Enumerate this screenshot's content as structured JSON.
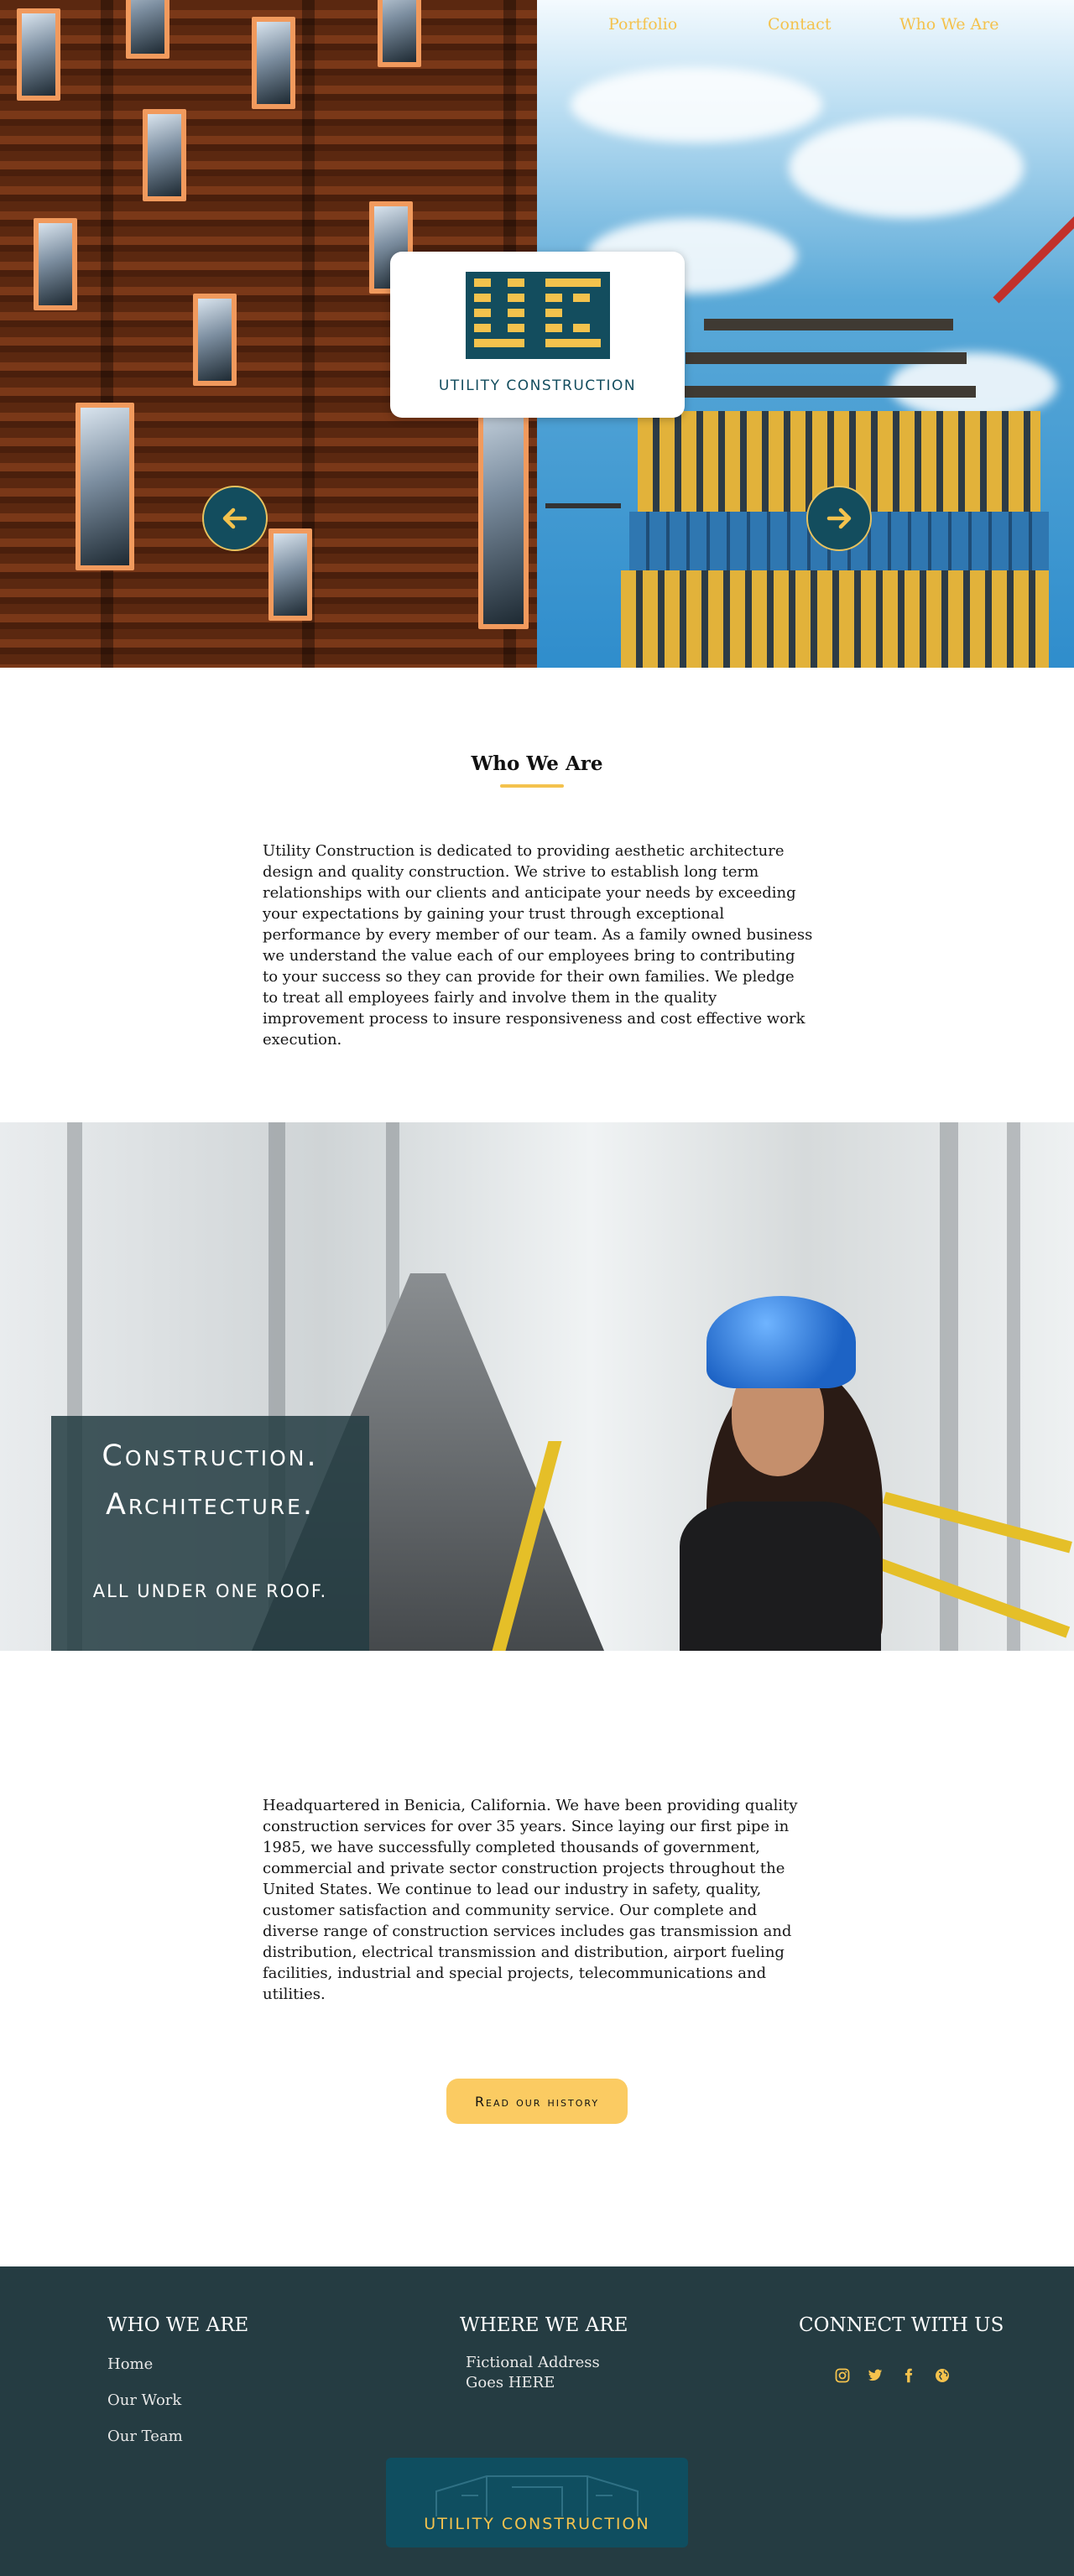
{
  "nav": {
    "items": [
      {
        "label": "Portfolio"
      },
      {
        "label": "Contact"
      },
      {
        "label": "Who We Are"
      }
    ]
  },
  "hero": {
    "logo_text": "UTILITY CONSTRUCTION",
    "prev_icon": "arrow-left-icon",
    "next_icon": "arrow-right-icon"
  },
  "who_we_are": {
    "title": "Who We Are",
    "paragraph": "Utility Construction is dedicated to providing aesthetic architecture design and quality construction. We strive to establish long term relationships with our clients and anticipate your needs by exceeding your expectations by gaining your trust through exceptional performance by every member of our team. As a family owned business we understand the value each of our employees bring to contributing to your success so they can provide for their own families. We pledge to treat all employees fairly and involve them in the quality improvement process to insure responsiveness and cost effective work execution."
  },
  "banner": {
    "line1": "Construction.",
    "line2": "Architecture.",
    "tagline": "ALL UNDER ONE ROOF."
  },
  "history": {
    "paragraph": "Headquartered in Benicia, California. We have been providing quality construction services for over 35 years. Since laying our first pipe in 1985, we have successfully completed thousands of government, commercial and private sector construction projects throughout the United States. We continue to lead our industry in safety, quality, customer satisfaction and community service. Our complete and diverse range of construction services includes gas transmission and distribution, electrical transmission and distribution, airport fueling facilities, industrial and special projects, telecommunications and utilities.",
    "cta_label": "Read our history"
  },
  "footer": {
    "who_heading": "WHO WE ARE",
    "who_links": [
      {
        "label": "Home"
      },
      {
        "label": "Our Work"
      },
      {
        "label": "Our Team"
      }
    ],
    "where_heading": "WHERE WE ARE",
    "address_line1": "Fictional Address",
    "address_line2": "Goes HERE",
    "connect_heading": "CONNECT WITH US",
    "social": [
      "instagram-icon",
      "twitter-icon",
      "facebook-icon",
      "globe-icon"
    ],
    "logo_text": "UTILITY CONSTRUCTION"
  },
  "colors": {
    "accent": "#f4c24d",
    "brand_teal": "#134d5e",
    "footer_bg": "#253c42",
    "cta_bg": "#fbcb62"
  }
}
